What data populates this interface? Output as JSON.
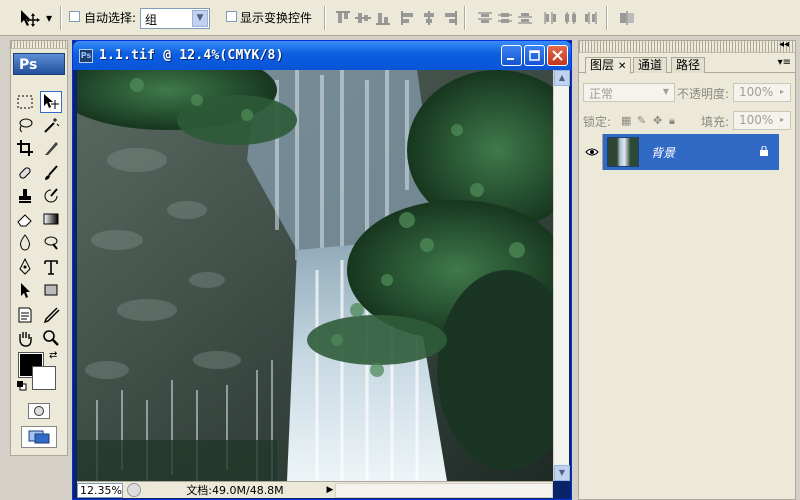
{
  "options_bar": {
    "auto_select_label": "自动选择:",
    "auto_select_value": "组",
    "show_transform_label": "显示变换控件"
  },
  "document": {
    "title": "1.1.tif @ 12.4%(CMYK/8)",
    "zoom": "12.35%",
    "doc_info": "文档:49.0M/48.8M"
  },
  "toolbox": {
    "logo": "Ps",
    "foreground_color": "#000000",
    "background_color": "#ffffff"
  },
  "layers_panel": {
    "tabs": [
      {
        "label": "图层"
      },
      {
        "label": "通道"
      },
      {
        "label": "路径"
      }
    ],
    "blend_mode": "正常",
    "opacity_label": "不透明度:",
    "opacity_value": "100%",
    "lock_label": "锁定:",
    "fill_label": "填充:",
    "fill_value": "100%",
    "layers": [
      {
        "name": "背景"
      }
    ]
  },
  "colors": {
    "titlebar_blue": "#0a54d8",
    "selection_blue": "#316ac5",
    "chrome": "#ece9d8"
  }
}
